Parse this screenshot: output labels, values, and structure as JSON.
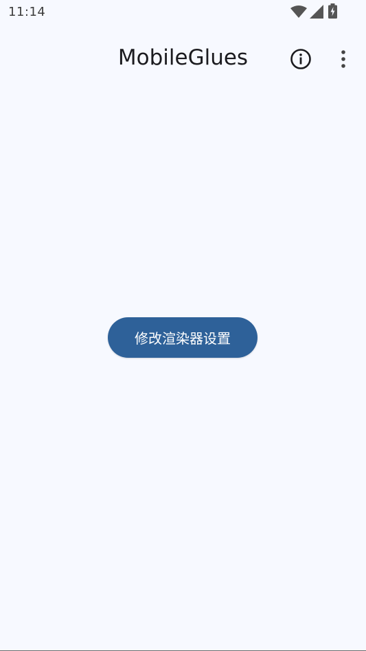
{
  "status_bar": {
    "time": "11:14",
    "icons": [
      "wifi-icon",
      "cell-signal-icon",
      "battery-charging-icon"
    ]
  },
  "app_bar": {
    "title": "MobileGlues",
    "actions": [
      "info-icon",
      "more-vert-icon"
    ]
  },
  "main": {
    "button_label": "修改渲染器设置"
  },
  "colors": {
    "background": "#f7f9ff",
    "primary": "#2e6199",
    "on_primary": "#ffffff",
    "title": "#1b1b1f"
  }
}
